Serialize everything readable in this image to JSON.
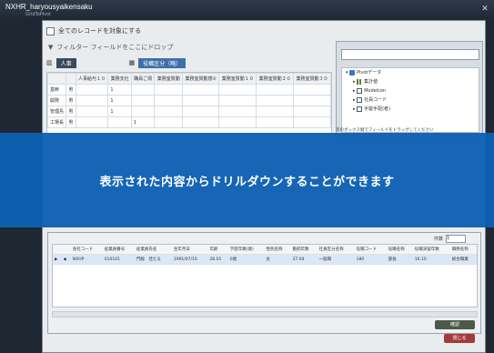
{
  "window": {
    "title": "NXHR_haryousyaikensaku",
    "subtitle": "GridToPivot"
  },
  "top": {
    "show_all_label": "全てのレコードを対象にする"
  },
  "filter": {
    "label": "フィルター フィールドをここにドロップ"
  },
  "rowbar": {
    "chip1": "人事",
    "chip2": "役職区分（略）"
  },
  "grid": {
    "headers": [
      "",
      "",
      "人事給与１０",
      "業務支社",
      "職員ご領",
      "業務室質動",
      "業務室質動感②",
      "業務室質動１０",
      "業務室質動２０",
      "業務室質動３０"
    ],
    "rows": [
      [
        "基幹",
        "男",
        "",
        "1",
        "",
        "",
        "",
        "",
        "",
        ""
      ],
      [
        "開発",
        "男",
        "",
        "1",
        "",
        "",
        "",
        "",
        "",
        ""
      ],
      [
        "管理島",
        "男",
        "",
        "1",
        "",
        "",
        "",
        "",
        "",
        ""
      ],
      [
        "工場長",
        "男",
        "",
        "",
        "1",
        "",
        "",
        "",
        "",
        ""
      ]
    ]
  },
  "side": {
    "tree": [
      {
        "label": "Pivotデータ",
        "icon": "cube-icon",
        "level": 0
      },
      {
        "label": "集計値",
        "icon": "bar-chart-icon",
        "level": 1
      },
      {
        "label": "Modelcon",
        "icon": "table-icon",
        "level": 1
      },
      {
        "label": "社員コード",
        "icon": "table-icon",
        "level": 1
      },
      {
        "label": "手錠手配(者)",
        "icon": "table-icon",
        "level": 1
      }
    ],
    "hint": "次のボックス間でフィールドをドラッグしてください"
  },
  "overlay": {
    "text": "表示された内容からドリルダウンすることができます"
  },
  "lower": {
    "count_label": "件数",
    "count_value": "1",
    "headers": [
      "",
      "",
      "会社コード",
      "従業員番号",
      "従業員氏名",
      "生年月日",
      "年齢",
      "学歴年数(歳)",
      "性別名称",
      "勤続年数",
      "社員区分名称",
      "役職コード",
      "役職名称",
      "役職滞留年数",
      "職務名称"
    ],
    "rows": [
      [
        "▶",
        "◆",
        "NXHP",
        "010101",
        "門脇　佳たる",
        "1991/07/10",
        "28.01",
        "0歳",
        "女",
        "27.04",
        "一般職",
        "180",
        "部長",
        "16.10",
        "総合職業"
      ]
    ],
    "ok_label": "確認",
    "close_label": "閉じる"
  }
}
